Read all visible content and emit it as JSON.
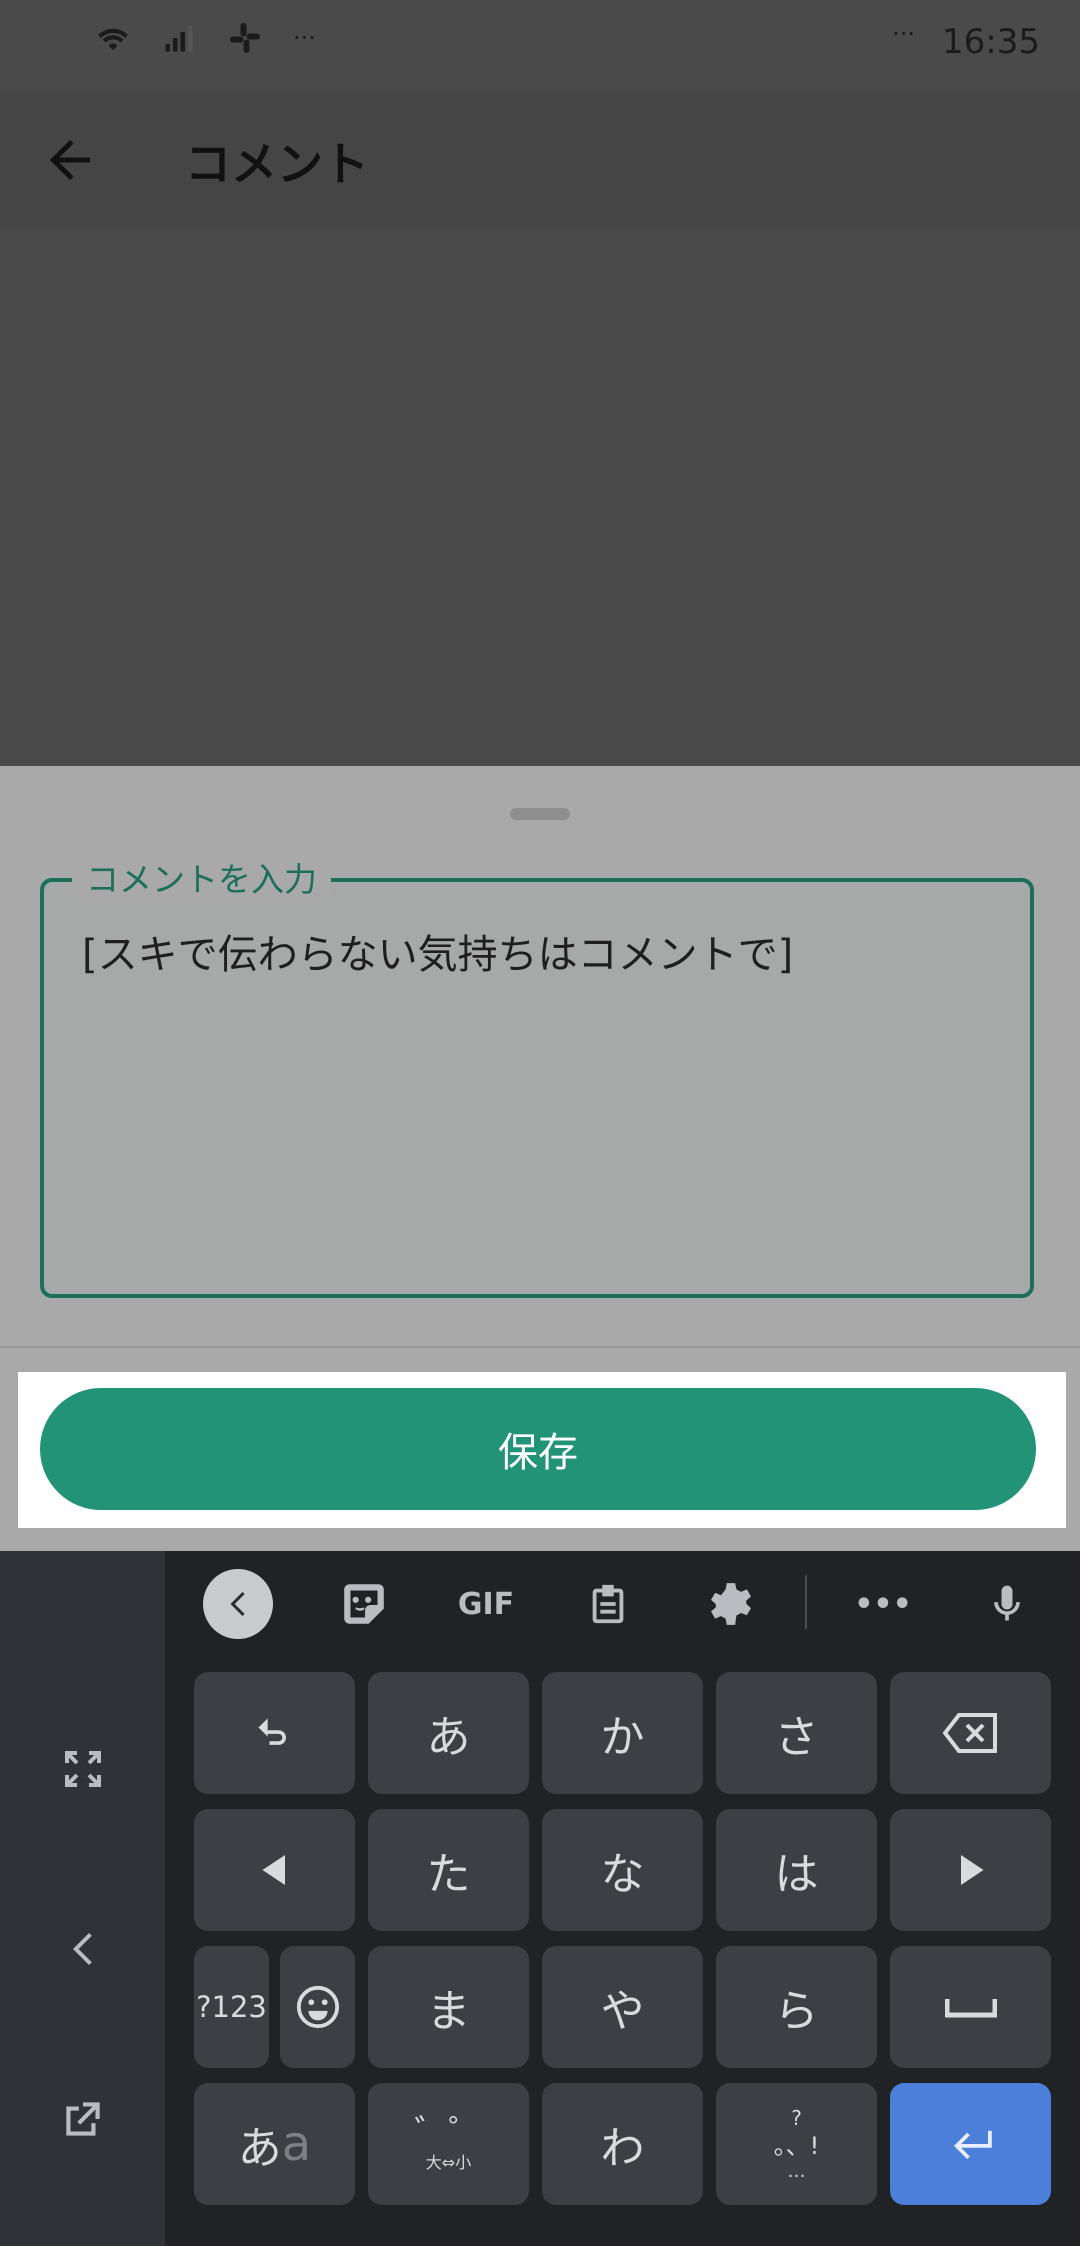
{
  "status_bar": {
    "time": "16:35",
    "more": "···",
    "left_more": "···"
  },
  "app_bar": {
    "title": "コメント"
  },
  "comment_sheet": {
    "field_label": "コメントを入力",
    "field_value": "[スキで伝わらない気持ちはコメントで]",
    "save_label": "保存"
  },
  "keyboard": {
    "toolbar": {
      "gif_label": "GIF",
      "more_label": "•••"
    },
    "keys": {
      "a": "あ",
      "ka": "か",
      "sa": "さ",
      "ta": "た",
      "na": "な",
      "ha": "は",
      "ma": "ま",
      "ya": "や",
      "ra": "ら",
      "wa": "わ",
      "num_mode": "?123",
      "kana_mode_main": "あ",
      "kana_mode_sub": "a",
      "dakuten_top": "゛゜",
      "dakuten_bottom": "大⇔小",
      "punct_top": "?",
      "punct_mid": "。、!",
      "punct_bottom": "…"
    }
  }
}
